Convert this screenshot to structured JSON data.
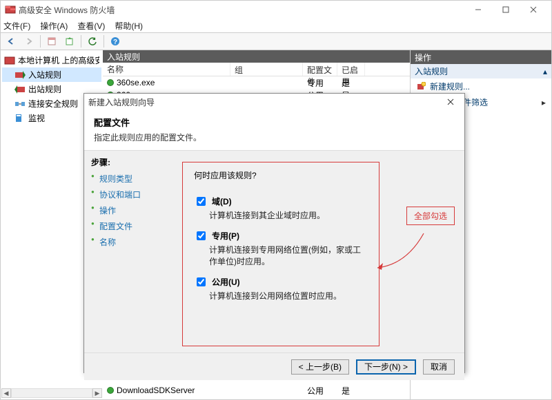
{
  "titlebar": {
    "title": "高级安全 Windows 防火墙"
  },
  "menubar": {
    "file": "文件(F)",
    "action": "操作(A)",
    "view": "查看(V)",
    "help": "帮助(H)"
  },
  "tree": {
    "root": "本地计算机 上的高级安全 Win",
    "items": [
      {
        "label": "入站规则",
        "selected": true
      },
      {
        "label": "出站规则",
        "selected": false
      },
      {
        "label": "连接安全规则",
        "selected": false
      },
      {
        "label": "监视",
        "selected": false
      }
    ]
  },
  "main": {
    "header": "入站规则",
    "columns": {
      "name": "名称",
      "group": "组",
      "profile": "配置文件",
      "enabled": "已启用"
    },
    "rows": [
      {
        "name": "360se.exe",
        "group": "",
        "profile": "专用",
        "enabled": "是"
      },
      {
        "name": "360se.exe",
        "group": "",
        "profile": "公用",
        "enabled": "是"
      },
      {
        "name": "DownloadSDKServer",
        "group": "",
        "profile": "公用",
        "enabled": "是"
      }
    ]
  },
  "actions": {
    "header": "操作",
    "section": "入站规则",
    "new_rule": "新建规则...",
    "filter_by_profile": "按配置文件筛选"
  },
  "dialog": {
    "title": "新建入站规则向导",
    "head_title": "配置文件",
    "head_sub": "指定此规则应用的配置文件。",
    "steps_title": "步骤:",
    "steps": [
      {
        "label": "规则类型"
      },
      {
        "label": "协议和端口"
      },
      {
        "label": "操作"
      },
      {
        "label": "配置文件",
        "current": true
      },
      {
        "label": "名称"
      }
    ],
    "question": "何时应用该规则?",
    "chk_domain": "域(D)",
    "chk_domain_desc": "计算机连接到其企业域时应用。",
    "chk_private": "专用(P)",
    "chk_private_desc": "计算机连接到专用网络位置(例如，家或工作单位)时应用。",
    "chk_public": "公用(U)",
    "chk_public_desc": "计算机连接到公用网络位置时应用。",
    "annot": "全部勾选",
    "btn_back": "< 上一步(B)",
    "btn_next": "下一步(N) >",
    "btn_cancel": "取消"
  }
}
